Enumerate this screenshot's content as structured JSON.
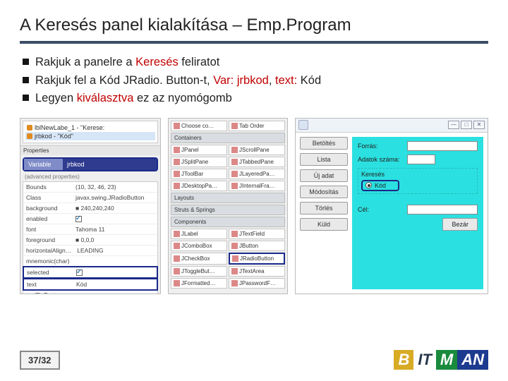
{
  "title": "A Keresés panel kialakítása – Emp.Program",
  "bullets": [
    {
      "pre": "Rakjuk a panelre a ",
      "hl1": "Keresés",
      "mid": " feliratot",
      "hl2": "",
      "mid2": "",
      "hl3": "",
      "post": ""
    },
    {
      "pre": "Rakjuk fel a Kód JRadio. Button-t, ",
      "hl1": "Var:",
      "mid": " ",
      "hl2": "jrbkod",
      "mid2": ", ",
      "hl3": "text:",
      "post": " Kód"
    },
    {
      "pre": "Legyen ",
      "hl1": "kiválasztva",
      "mid": " ez az nyomógomb",
      "hl2": "",
      "mid2": "",
      "hl3": "",
      "post": ""
    }
  ],
  "tree": {
    "row1": "lblNewLabe_1 - \"Kerese:",
    "row2": "jrbkod - \"Kód\""
  },
  "propsTab": "Properties",
  "variable": {
    "label": "Variable",
    "value": "jrbkod"
  },
  "hint": "(advanced properties)",
  "props": [
    {
      "k": "Bounds",
      "v": "(10, 32, 46, 23)"
    },
    {
      "k": "Class",
      "v": "javax.swing.JRadioButton"
    },
    {
      "k": "background",
      "v": "■ 240,240,240"
    },
    {
      "k": "enabled",
      "v": "",
      "check": true
    },
    {
      "k": "font",
      "v": "Tahoma 11"
    },
    {
      "k": "foreground",
      "v": "■ 0,0,0"
    },
    {
      "k": "horizontalAlign…",
      "v": "LEADING"
    },
    {
      "k": "mnemonic(char)",
      "v": ""
    },
    {
      "k": "selected",
      "v": "",
      "check": true,
      "hi": true
    },
    {
      "k": "text",
      "v": "Kód",
      "hi": true
    },
    {
      "k": "toolTipText",
      "v": ""
    }
  ],
  "palette": {
    "top": [
      "Choose co…",
      "Tab Order"
    ],
    "groups": [
      {
        "h": "Containers",
        "items": [
          "JPanel",
          "JScrollPane",
          "JSplitPane",
          "JTabbedPane",
          "JToolBar",
          "JLayeredPa…",
          "JDesktopPa…",
          "JInternalFra…"
        ]
      },
      {
        "h": "Layouts",
        "items": []
      },
      {
        "h": "Struts & Springs",
        "items": []
      },
      {
        "h": "Components",
        "items": [
          "JLabel",
          "JTextField",
          "JComboBox",
          "JButton",
          "JCheckBox",
          "JRadioButton",
          "JToggleBut…",
          "JTextArea",
          "JFormatted…",
          "JPasswordF…"
        ]
      }
    ],
    "highlight": "JRadioButton"
  },
  "window": {
    "buttons": [
      "Betöltés",
      "Lista",
      "Új adat",
      "Módosítás",
      "Törlés",
      "Küld"
    ],
    "labels": {
      "forras": "Forrás:",
      "adatok": "Adatok száma:",
      "kereses": "Keresés",
      "kod": "Kód",
      "cel": "Cél:"
    },
    "bezar": "Bezár"
  },
  "page": "37/32",
  "logo": {
    "b": "B",
    "it": "IT",
    "m": "M",
    "an": "AN"
  }
}
